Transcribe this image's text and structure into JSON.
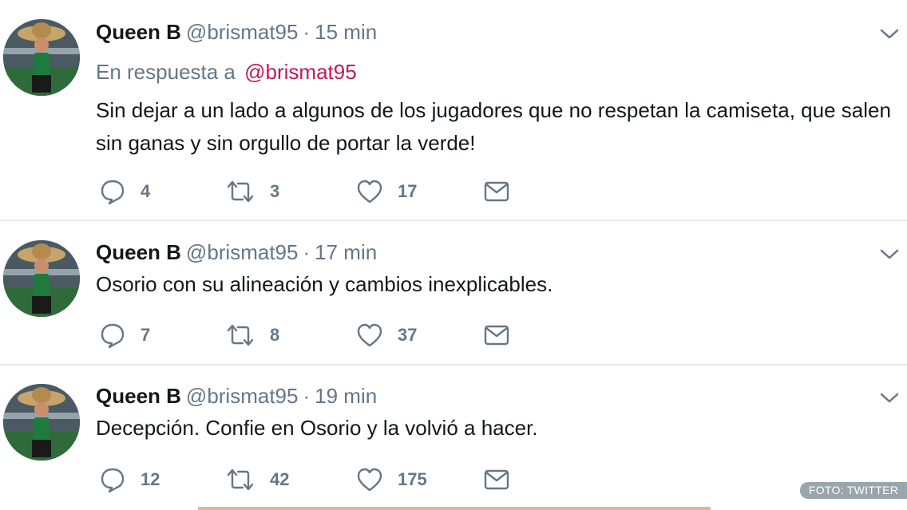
{
  "tweets": [
    {
      "name": "Queen B",
      "handle": "@brismat95",
      "separator": "·",
      "time": "15 min",
      "reply_prefix": "En respuesta a",
      "reply_mention": "@brismat95",
      "text": "Sin dejar a un lado a algunos de los jugadores que no respetan la camiseta, que salen sin ganas y sin orgullo de portar la verde!",
      "replies": "4",
      "retweets": "3",
      "likes": "17"
    },
    {
      "name": "Queen B",
      "handle": "@brismat95",
      "separator": "·",
      "time": "17 min",
      "text": "Osorio con su alineación y cambios inexplicables.",
      "replies": "7",
      "retweets": "8",
      "likes": "37"
    },
    {
      "name": "Queen B",
      "handle": "@brismat95",
      "separator": "·",
      "time": "19 min",
      "text": "Decepción. Confie en Osorio y la volvió a hacer.",
      "replies": "12",
      "retweets": "42",
      "likes": "175"
    }
  ],
  "icons": {
    "reply": "reply-icon",
    "retweet": "retweet-icon",
    "like": "heart-icon",
    "message": "envelope-icon",
    "menu": "chevron-down-icon"
  },
  "colors": {
    "mention": "#c2185b",
    "secondary_text": "#657786",
    "primary_text": "#14171a",
    "divider": "#e6ecf0"
  },
  "credit": "FOTO: TWITTER"
}
